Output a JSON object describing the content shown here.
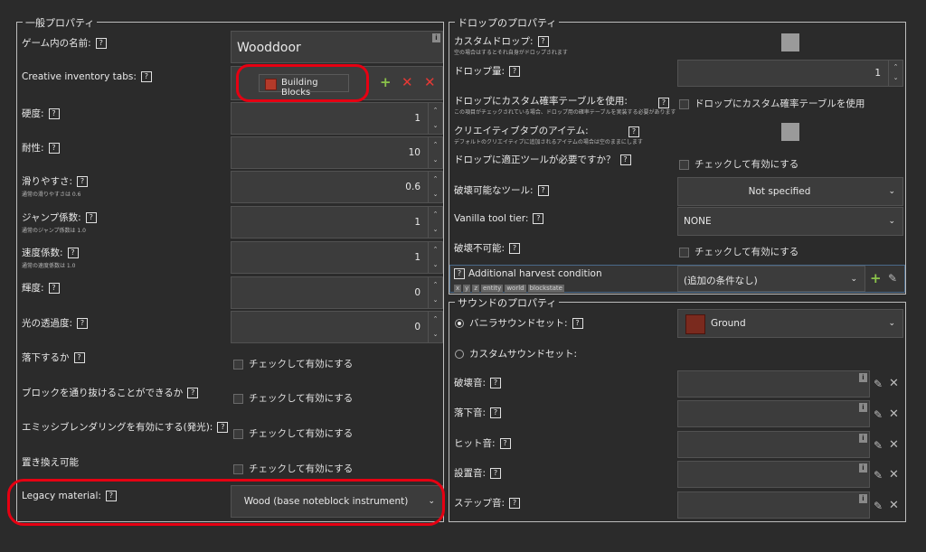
{
  "general": {
    "title": "一般プロパティ",
    "name_label": "ゲーム内の名前:",
    "name_value": "Wooddoor",
    "tabs_label": "Creative inventory tabs:",
    "tab_chip": "Building Blocks",
    "hardness_label": "硬度:",
    "hardness_value": "1",
    "resistance_label": "耐性:",
    "resistance_value": "10",
    "slipperiness_label": "滑りやすさ:",
    "slipperiness_note": "通常の滑りやすさは 0.6",
    "slipperiness_value": "0.6",
    "jump_label": "ジャンプ係数:",
    "jump_note": "通常のジャンプ係数は 1.0",
    "jump_value": "1",
    "speed_label": "速度係数:",
    "speed_note": "通常の速度係数は 1.0",
    "speed_value": "1",
    "luminance_label": "輝度:",
    "luminance_value": "0",
    "opacity_label": "光の透過度:",
    "opacity_value": "0",
    "falls_label": "落下するか",
    "passable_label": "ブロックを通り抜けることができるか",
    "emissive_label": "エミッシブレンダリングを有効にする(発光):",
    "replaceable_label": "置き換え可能",
    "check_text": "チェックして有効にする",
    "legacy_label": "Legacy material:",
    "legacy_value": "Wood (base noteblock instrument)"
  },
  "drop": {
    "title": "ドロップのプロパティ",
    "custom_drop_label": "カスタムドロップ:",
    "custom_drop_note": "空の場合はするとそれ自身がドロップされます",
    "amount_label": "ドロップ量:",
    "amount_value": "1",
    "loot_label": "ドロップにカスタム確率テーブルを使用:",
    "loot_note": "この項目がチェックされている場合、ドロップ用の確率テーブルを実装する必要があります",
    "loot_check": "ドロップにカスタム確率テーブルを使用",
    "creative_item_label": "クリエイティブタブのアイテム:",
    "creative_item_note": "デフォルトのクリエイティブに追加されるアイテムの場合は空のままにします",
    "tool_req_label": "ドロップに適正ツールが必要ですか？",
    "tool_req_check": "チェックして有効にする",
    "tool_label": "破壊可能なツール:",
    "tool_value": "Not specified",
    "tier_label": "Vanilla tool tier:",
    "tier_value": "NONE",
    "unbreakable_label": "破壊不可能:",
    "unbreakable_check": "チェックして有効にする",
    "harvest_label": "Additional harvest condition",
    "harvest_tags": [
      "x",
      "y",
      "z",
      "entity",
      "world",
      "blockstate"
    ],
    "harvest_value": "(追加の条件なし)"
  },
  "sound": {
    "title": "サウンドのプロパティ",
    "vanilla_label": "バニラサウンドセット:",
    "vanilla_value": "Ground",
    "custom_label": "カスタムサウンドセット:",
    "break_label": "破壊音:",
    "fall_label": "落下音:",
    "hit_label": "ヒット音:",
    "place_label": "設置音:",
    "step_label": "ステップ音:"
  },
  "colors": {
    "background": "#2b2b2b",
    "highlight_ring": "#e60012",
    "add_green": "#8bc34a",
    "remove_red": "#e53935"
  }
}
